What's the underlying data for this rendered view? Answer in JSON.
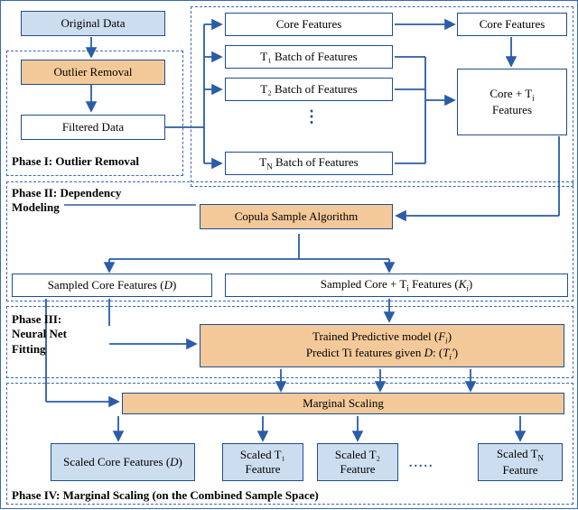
{
  "labels": {
    "original_data": "Original Data",
    "outlier_removal": "Outlier Removal",
    "filtered_data": "Filtered Data",
    "core_features_top": "Core Features",
    "core_features_right": "Core Features",
    "t1_batch": "T₁ Batch of Features",
    "t2_batch": "T₂ Batch of Features",
    "tn_batch": "T",
    "tn_batch_sub": "N",
    "tn_batch_rest": " Batch of Features",
    "core_ti_features_pre": "Core + T",
    "core_ti_features_sub": "i",
    "core_ti_features_post": " Features",
    "copula": "Copula Sample Algorithm",
    "sampled_core": "Sampled Core Features (",
    "sampled_core_d": "D",
    "sampled_core_end": ")",
    "sampled_core_ti_pre": "Sampled Core + T",
    "sampled_core_ti_sub": "i",
    "sampled_core_ti_mid": " Features (",
    "sampled_core_ti_k": "K",
    "sampled_core_ti_ksub": "i",
    "sampled_core_ti_end": ")",
    "trained_line1_pre": "Trained Predictive model (",
    "trained_line1_f": "F",
    "trained_line1_sub": "i",
    "trained_line1_end": ")",
    "trained_line2_pre": "Predict Ti features given ",
    "trained_line2_d": "D",
    "trained_line2_colon": ": (",
    "trained_line2_t": "T",
    "trained_line2_sub": "i",
    "trained_line2_prime": "′",
    "trained_line2_end": ")",
    "marginal_scaling": "Marginal Scaling",
    "scaled_core_pre": "Scaled Core Features (",
    "scaled_core_d": "D",
    "scaled_core_end": ")",
    "scaled_t1_line1": "Scaled T₁",
    "scaled_t1_line2": "Feature",
    "scaled_t2_line1": "Scaled T₂",
    "scaled_t2_line2": "Feature",
    "scaled_tn_line1_pre": "Scaled T",
    "scaled_tn_line1_sub": "N",
    "scaled_tn_line2": "Feature"
  },
  "phases": {
    "p1": "Phase I: Outlier Removal",
    "p2_line1": "Phase II: Dependency",
    "p2_line2": "Modeling",
    "p3_line1": "Phase III:",
    "p3_line2": "Neural Net",
    "p3_line3": "Fitting",
    "p4": "Phase IV: Marginal Scaling (on the Combined Sample Space)"
  },
  "dots_vert": "⋮",
  "dots_horiz": "....."
}
